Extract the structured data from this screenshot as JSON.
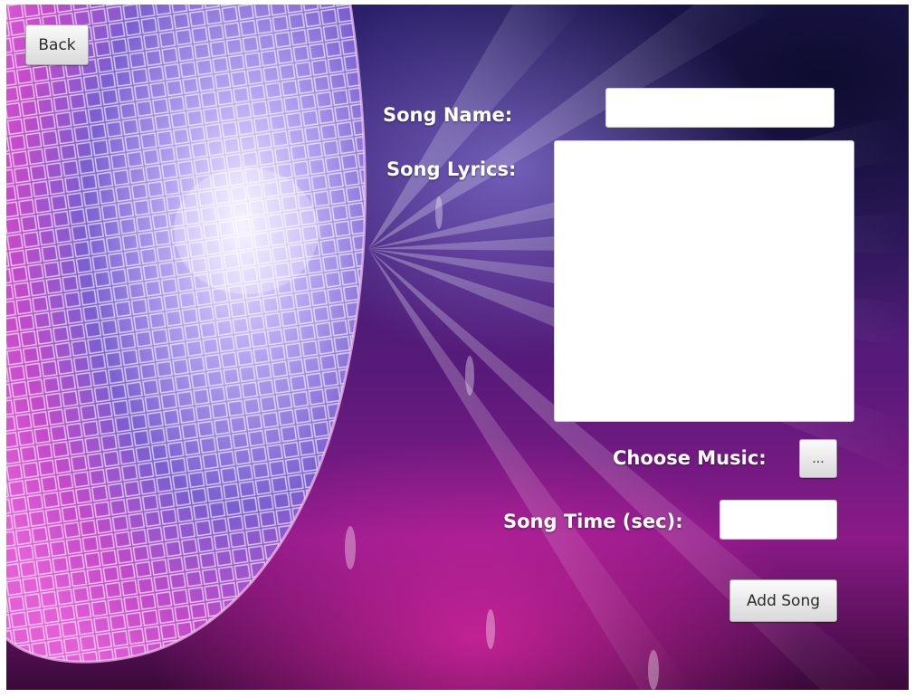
{
  "back_button": {
    "label": "Back"
  },
  "form": {
    "song_name_label": "Song Name:",
    "song_name_value": "",
    "lyrics_label": "Song Lyrics:",
    "lyrics_value": "",
    "choose_music_label": "Choose Music:",
    "browse_button_label": "...",
    "song_time_label": "Song Time (sec):",
    "song_time_value": "",
    "add_song_label": "Add Song"
  },
  "colors": {
    "background_top": "#2a1f6a",
    "background_bottom": "#8a1a88",
    "label_text": "#ffffff"
  },
  "icons": {
    "background": "disco-ball-image"
  }
}
